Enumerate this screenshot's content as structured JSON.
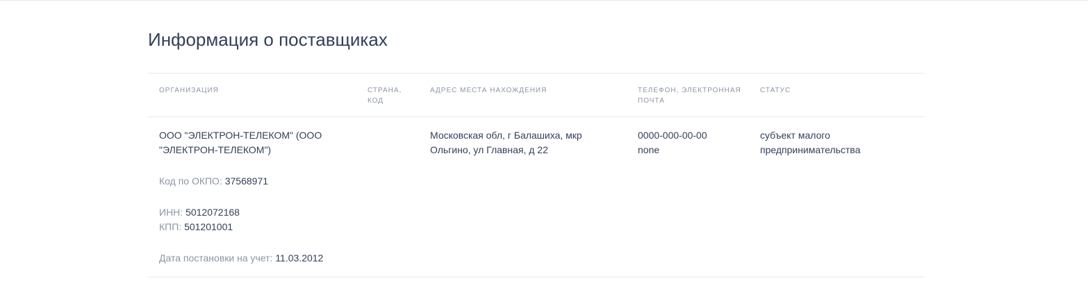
{
  "page": {
    "title": "Информация о поставщиках"
  },
  "table": {
    "headers": {
      "organization": "ОРГАНИЗАЦИЯ",
      "country_line1": "СТРАНА,",
      "country_line2": "КОД",
      "address": "АДРЕС МЕСТА НАХОЖДЕНИЯ",
      "contact_line1": "ТЕЛЕФОН, ЭЛЕКТРОННАЯ",
      "contact_line2": "ПОЧТА",
      "status": "СТАТУС"
    },
    "rows": [
      {
        "organization_name": "ООО \"ЭЛЕКТРОН-ТЕЛЕКОМ\" (ООО \"ЭЛЕКТРОН-ТЕЛЕКОМ\")",
        "okpo_label": "Код по ОКПО:",
        "okpo_value": "37568971",
        "inn_label": "ИНН:",
        "inn_value": "5012072168",
        "kpp_label": "КПП:",
        "kpp_value": "501201001",
        "reg_date_label": "Дата постановки на учет:",
        "reg_date_value": "11.03.2012",
        "country": "",
        "address_line1": "Московская обл, г Балашиха, мкр",
        "address_line2": "Ольгино, ул Главная, д 22",
        "phone": "0000-000-00-00",
        "email": "none",
        "status_line1": "субъект малого",
        "status_line2": "предпринимательства"
      }
    ]
  }
}
